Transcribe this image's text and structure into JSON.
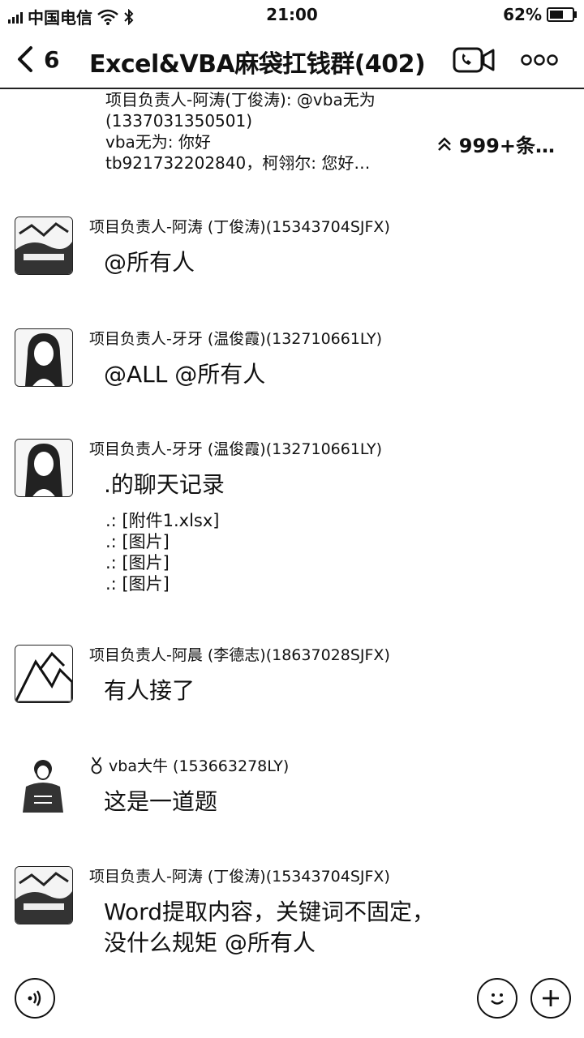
{
  "status_bar": {
    "carrier": "中国电信",
    "time": "21:00",
    "battery": "62%",
    "battery_level": 0.62
  },
  "header": {
    "back_count": "6",
    "title": "Excel&VBA麻袋扛钱群(402)"
  },
  "quoted": [
    "项目负责人-阿涛(丁俊涛): @vba无为",
    "(1337031350501)",
    "vba无为: 你好",
    "tb921732202840，柯翎尔: 您好…"
  ],
  "new_messages": "999+条…",
  "messages": [
    {
      "sender": "项目负责人-阿涛 (丁俊涛)(15343704SJFX)",
      "text": "@所有人"
    },
    {
      "sender": "项目负责人-牙牙 (温俊霞)(132710661LY)",
      "text": "@ALL @所有人"
    },
    {
      "sender": "项目负责人-牙牙 (温俊霞)(132710661LY)",
      "text": ".的聊天记录",
      "records": [
        ".: [附件1.xlsx]",
        ".: [图片]",
        ".: [图片]",
        ".: [图片]"
      ]
    },
    {
      "sender": "项目负责人-阿晨 (李德志)(18637028SJFX)",
      "text": "有人接了"
    },
    {
      "sender": "vba大牛 (153663278LY)",
      "text": "这是一道题"
    },
    {
      "sender": "项目负责人-阿涛 (丁俊涛)(15343704SJFX)",
      "text": "Word提取内容，关键词不固定，没什么规矩 @所有人"
    }
  ]
}
